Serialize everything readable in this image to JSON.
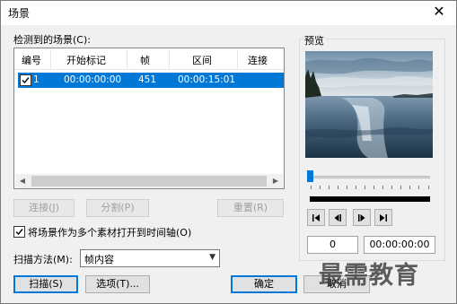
{
  "window": {
    "title": "场景"
  },
  "scenes": {
    "label": "检测到的场景(C):",
    "columns": [
      "编号",
      "开始标记",
      "帧",
      "区间",
      "连接"
    ],
    "rows": [
      {
        "checked": true,
        "number": "1",
        "start": "00:00:00:00",
        "frames": "451",
        "duration": "00:00:15:01"
      }
    ]
  },
  "buttons": {
    "link": "连接(J)",
    "split": "分割(P)",
    "reset": "重置(R)",
    "scan": "扫描(S)",
    "options": "选项(T)...",
    "ok": "确定",
    "cancel": "取消"
  },
  "open_multiple": {
    "checked": true,
    "label": "将场景作为多个素材打开到时间轴(O)"
  },
  "scan_method": {
    "label": "扫描方法(M):",
    "value": "帧内容"
  },
  "preview": {
    "label": "预览",
    "slider_position": 0,
    "frame_value": "0",
    "timecode_value": "00:00:00:00"
  },
  "watermark": "最需教育"
}
